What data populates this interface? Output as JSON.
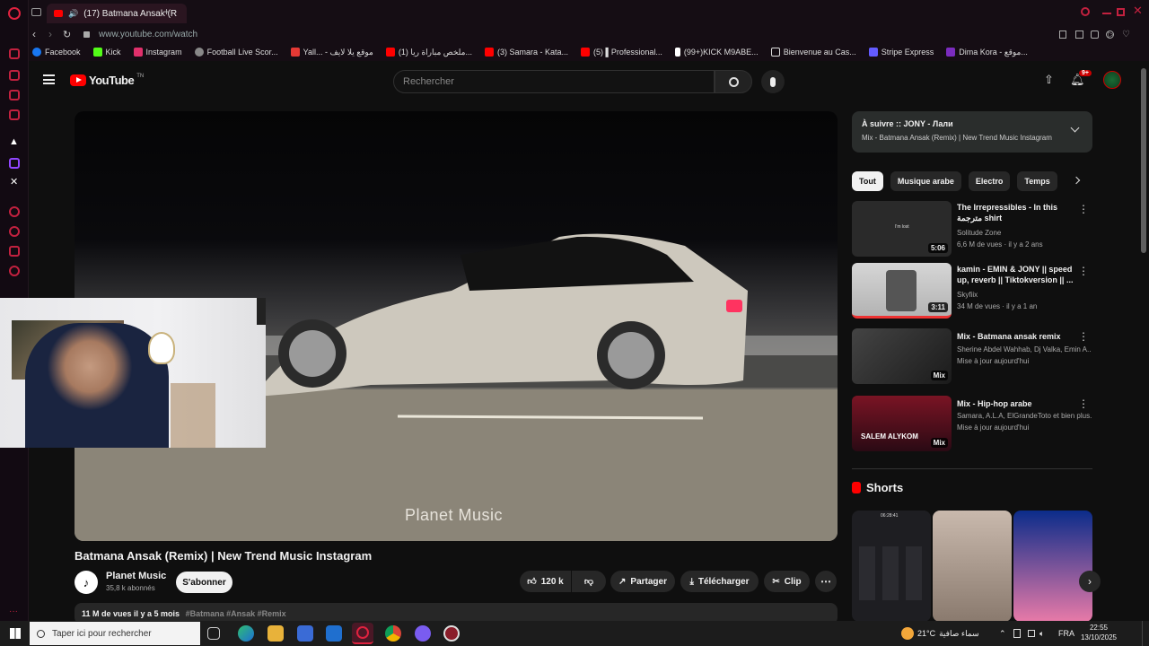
{
  "browser": {
    "tab_title": "(17) Batmana Ansak (R",
    "url": "www.youtube.com/watch",
    "bookmarks": [
      {
        "label": "Facebook",
        "color": "#1877f2"
      },
      {
        "label": "Kick",
        "color": "#53fc18"
      },
      {
        "label": "Instagram",
        "color": "#e1306c"
      },
      {
        "label": "Football Live Scor...",
        "color": "#888888"
      },
      {
        "label": "Yall... - موقع يلا لايف",
        "color": "#e53935"
      },
      {
        "label": "(1) ملخص مباراة ريا...",
        "color": "#ff0000"
      },
      {
        "label": "(3) Samara - Kata...",
        "color": "#ff0000"
      },
      {
        "label": "(5) ▌Professional...",
        "color": "#ff0000"
      },
      {
        "label": "(99+)KICK M9ABE...",
        "color": "#ffffff"
      },
      {
        "label": "Bienvenue au Cas...",
        "color": "#dddddd"
      },
      {
        "label": "Stripe Express",
        "color": "#635bff"
      },
      {
        "label": "Dima Kora - موقع...",
        "color": "#7b2cbf"
      }
    ]
  },
  "header": {
    "logo": "YouTube",
    "country": "TN",
    "search_placeholder": "Rechercher",
    "notif_count": "9+"
  },
  "video": {
    "watermark": "Planet Music",
    "title": "Batmana Ansak (Remix) | New Trend Music Instagram",
    "channel": "Planet Music",
    "subscribers": "35,8 k abonnés",
    "subscribe": "S'abonner",
    "likes": "120 k",
    "share": "Partager",
    "download": "Télécharger",
    "clip": "Clip",
    "views_date": "11 M de vues  il y a 5 mois",
    "hashtags": "#Batmana #Ansak #Remix"
  },
  "up_next": {
    "title": "À suivre :: JONY - Лали",
    "subtitle": "Mix - Batmana Ansak (Remix) | New Trend Music Instagram"
  },
  "chips": [
    "Tout",
    "Musique arabe",
    "Electro",
    "Temps"
  ],
  "recommendations": [
    {
      "title": "The Irrepressibles - In this مترجمة shirt",
      "channel": "Solitude Zone",
      "meta": "6,6 M de vues · il y a 2 ans",
      "duration": "5:06",
      "thumb_color": "#2a2a2a"
    },
    {
      "title": "kamin - EMIN & JONY || speed up, reverb || Tiktokversion || ...",
      "channel": "Skyfiix",
      "meta": "34 M de vues · il y a 1 an",
      "duration": "3:11",
      "thumb_color": "#c9c9c9"
    },
    {
      "title": "Mix - Batmana ansak remix",
      "channel": "Sherine Abdel Wahhab, Dj Valka, Emin A...",
      "meta": "Mise à jour aujourd'hui",
      "duration": "Mix",
      "thumb_color": "#3a3a3a"
    },
    {
      "title": "Mix - Hip-hop arabe",
      "channel": "Samara, A.L.A, ElGrandeToto et bien plus...",
      "meta": "Mise à jour aujourd'hui",
      "duration": "Mix",
      "thumb_color": "#5a0f1a"
    }
  ],
  "rec_thumb_text": [
    "I'm lost",
    "SALEM ALYKOM"
  ],
  "shorts": {
    "heading": "Shorts",
    "clock": "06:28:41"
  },
  "taskbar": {
    "search": "Taper ici pour rechercher",
    "weather": "21°C",
    "weather_text": "سماء صافية",
    "lang": "FRA",
    "time": "22:55",
    "date": "13/10/2025"
  }
}
